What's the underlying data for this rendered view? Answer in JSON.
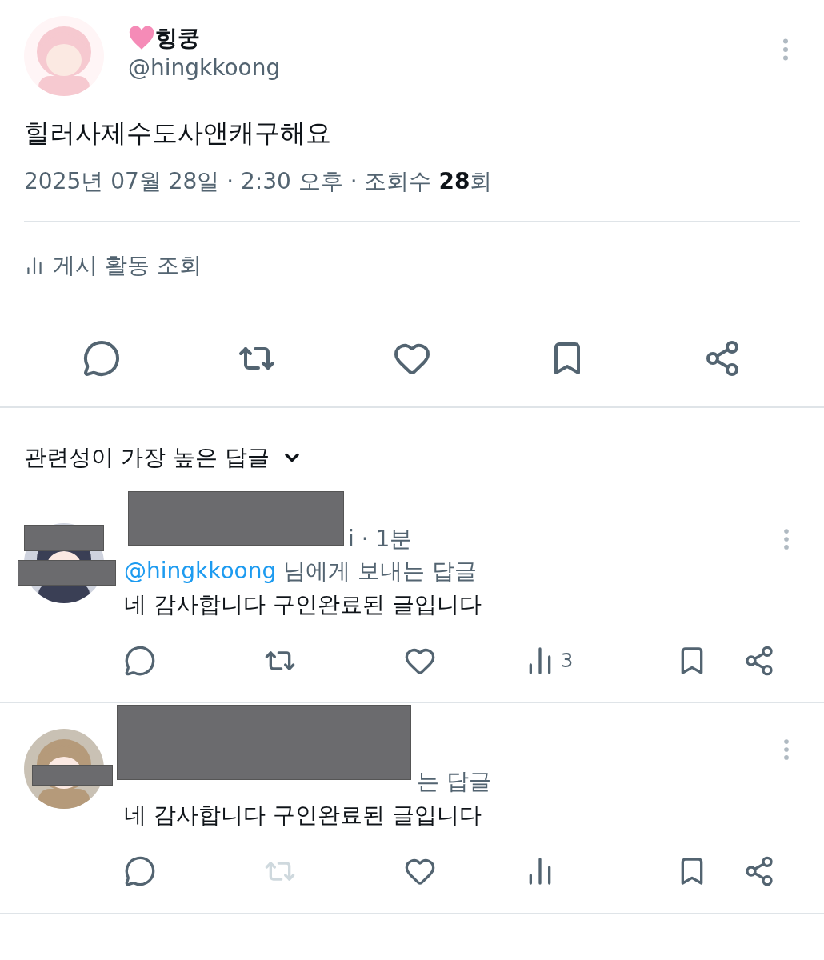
{
  "post": {
    "author": {
      "name": "힝쿵",
      "handle": "@hingkkoong"
    },
    "text": "힐러사제수도사앤캐구해요",
    "meta": "2025년 07월 28일 · 2:30 오후 · 조회수 **28**회",
    "activity_link": "게시 활동 조회",
    "actions": [
      {
        "kind": "reply"
      },
      {
        "kind": "repost"
      },
      {
        "kind": "like"
      },
      {
        "kind": "bookmark"
      },
      {
        "kind": "share"
      }
    ]
  },
  "replies_sort": {
    "label": "관련성이 가장 높은 답글"
  },
  "replies": [
    {
      "header": "i · 1분",
      "mention": "@hingkkoong",
      "mention_suffix": "님에게 보내는 답글",
      "text": "네 감사합니다 구인완료된 글입니다",
      "actions": [
        {
          "kind": "reply",
          "disabled": false
        },
        {
          "kind": "repost",
          "disabled": false
        },
        {
          "kind": "like",
          "disabled": false
        },
        {
          "kind": "views",
          "disabled": false,
          "count": "3"
        },
        {
          "kind": "bookmark",
          "disabled": false
        },
        {
          "kind": "share",
          "disabled": false
        }
      ]
    },
    {
      "mention_suffix": "는 답글",
      "text": "네 감사합니다 구인완료된 글입니다",
      "actions": [
        {
          "kind": "reply",
          "disabled": false
        },
        {
          "kind": "repost",
          "disabled": true
        },
        {
          "kind": "like",
          "disabled": false
        },
        {
          "kind": "views",
          "disabled": false
        },
        {
          "kind": "bookmark",
          "disabled": false
        },
        {
          "kind": "share",
          "disabled": false
        }
      ]
    }
  ]
}
